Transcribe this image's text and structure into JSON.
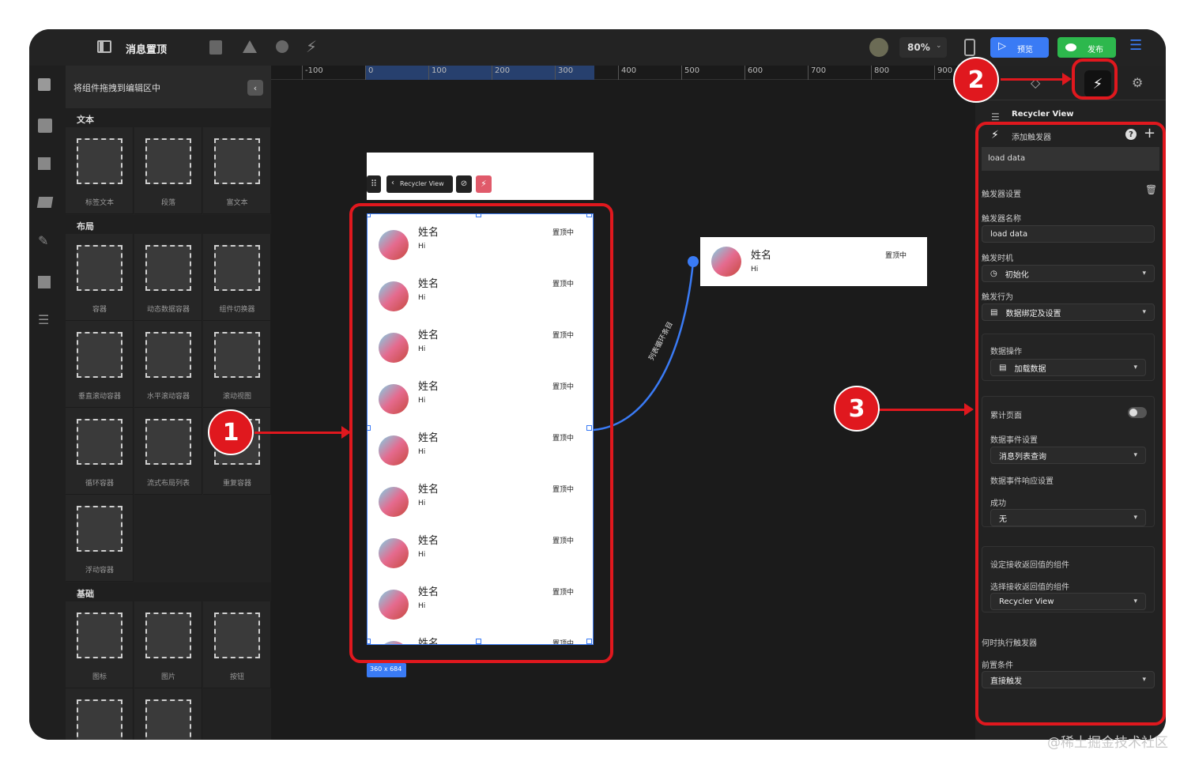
{
  "app": {
    "page_title": "消息置顶",
    "zoom": "80%",
    "preview_label": "预览",
    "publish_label": "发布"
  },
  "palette": {
    "hint": "将组件拖拽到编辑区中",
    "sections": {
      "text": "文本",
      "layout": "布局",
      "basic": "基础"
    },
    "text_items": [
      "标签文本",
      "段落",
      "富文本"
    ],
    "layout_items": [
      "容器",
      "动态数据容器",
      "组件切换器",
      "垂直滚动容器",
      "水平滚动容器",
      "滚动视图",
      "循环容器",
      "流式布局列表",
      "重复容器",
      "浮动容器"
    ],
    "basic_items": [
      "图标",
      "图片",
      "按钮"
    ]
  },
  "ruler": {
    "ticks": [
      "-100",
      "0",
      "100",
      "200",
      "300",
      "400",
      "500",
      "600",
      "700",
      "800",
      "900"
    ]
  },
  "canvas": {
    "toolbar_component": "Recycler View",
    "list_items": [
      {
        "name": "姓名",
        "msg": "Hi",
        "tag": "置顶中"
      },
      {
        "name": "姓名",
        "msg": "Hi",
        "tag": "置顶中"
      },
      {
        "name": "姓名",
        "msg": "Hi",
        "tag": "置顶中"
      },
      {
        "name": "姓名",
        "msg": "Hi",
        "tag": "置顶中"
      },
      {
        "name": "姓名",
        "msg": "Hi",
        "tag": "置顶中"
      },
      {
        "name": "姓名",
        "msg": "Hi",
        "tag": "置顶中"
      },
      {
        "name": "姓名",
        "msg": "Hi",
        "tag": "置顶中"
      },
      {
        "name": "姓名",
        "msg": "Hi",
        "tag": "置顶中"
      },
      {
        "name": "姓名",
        "msg": "",
        "tag": "置顶中"
      }
    ],
    "size_badge": "360 x 684",
    "connector_label": "列表循环条目",
    "template_item": {
      "name": "姓名",
      "msg": "Hi",
      "tag": "置顶中"
    }
  },
  "panel": {
    "component": "Recycler View",
    "add_trigger": "添加触发器",
    "trigger_item": "load data",
    "settings_title": "触发器设置",
    "name_label": "触发器名称",
    "name_value": "load data",
    "time_label": "触发时机",
    "time_value": "初始化",
    "action_label": "触发行为",
    "action_value": "数据绑定及设置",
    "data_op_label": "数据操作",
    "data_op_value": "加载数据",
    "accumulate_label": "累计页面",
    "event_label": "数据事件设置",
    "event_value": "消息列表查询",
    "response_label": "数据事件响应设置",
    "success_label": "成功",
    "success_value": "无",
    "receiver_title": "设定接收返回值的组件",
    "receiver_label": "选择接收返回值的组件",
    "receiver_value": "Recycler View",
    "when_label": "何时执行触发器",
    "precond_label": "前置条件",
    "precond_value": "直接触发"
  },
  "annotations": [
    "1",
    "2",
    "3"
  ],
  "watermark": "@稀土掘金技术社区",
  "colors": {
    "accent": "#3a7bf5",
    "publish": "#2db84d",
    "annotation": "#e0181e"
  }
}
